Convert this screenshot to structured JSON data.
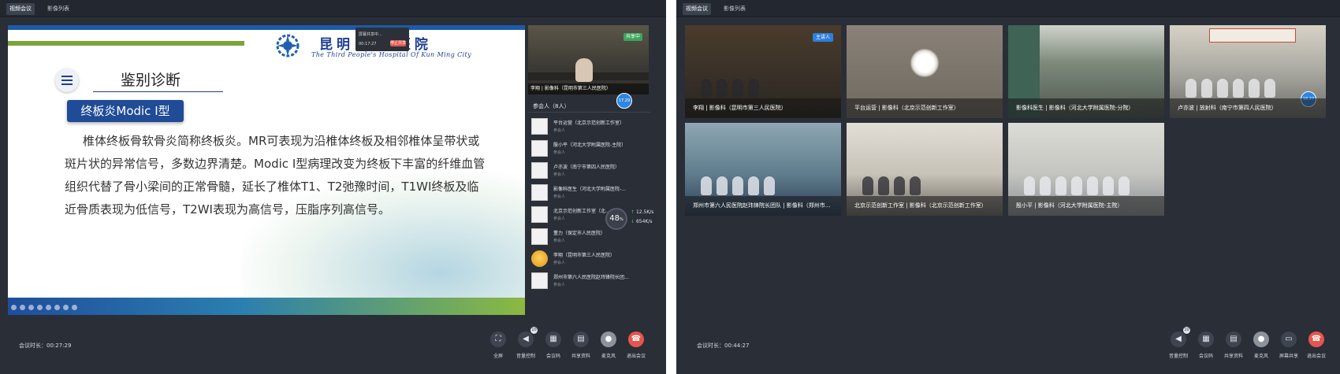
{
  "windowA": {
    "tabs": [
      {
        "label": "视频会议"
      },
      {
        "label": "影像列表"
      }
    ],
    "slide": {
      "hospital_cn": "昆明   人民医院",
      "hospital_en": "The Third People's Hospital Of Kun Ming City",
      "title": "鉴别诊断",
      "subtitle": "终板炎Modic I型",
      "body": "椎体终板骨软骨炎简称终板炎。MR可表现为沿椎体终板及相邻椎体呈带状或斑片状的异常信号，多数边界清楚。Modic I型病理改变为终板下丰富的纤维血管组织代替了骨小梁间的正常骨髓，延长了椎体T1、T2弛豫时间，T1WI终板及临近骨质表现为低信号，T2WI表现为高信号，压脂序列高信号。"
    },
    "popup": {
      "line1": "屏幕共享中...",
      "line2": "00:17:27",
      "button": "停止共享"
    },
    "camera": {
      "name": "李翔 | 影像科（昆明市第三人民医院）",
      "share_badge": "共享中"
    },
    "blue_badge": "17.29",
    "participants_header": "参会人（8人）",
    "participants": [
      {
        "name": "平台运营（北京示范创新工作室）",
        "role": "参会人"
      },
      {
        "name": "殷小平（河北大学附属医院-主院）",
        "role": "参会人"
      },
      {
        "name": "卢亦波（南宁市第四人民医院）",
        "role": "参会人"
      },
      {
        "name": "影像科医生（河北大学附属医院-...",
        "role": "参会人"
      },
      {
        "name": "北京示范创新工作室（北...",
        "role": "参会人"
      },
      {
        "name": "董力（保定市人民医院）",
        "role": "参会人"
      },
      {
        "name": "李翔（昆明市第三人民医院）",
        "role": "参会人"
      },
      {
        "name": "郑州市第六人民医院赵玮锋院长团...",
        "role": "参会人"
      }
    ],
    "speed": {
      "percent": "48",
      "unit": "%",
      "up": "12.5",
      "down": "654",
      "up_unit": "K/s",
      "down_unit": "K/s"
    },
    "duration": "会议时长：00:27:29",
    "controls": [
      {
        "label": "全屏",
        "icon": "fullscreen-icon",
        "glyph": "⛶"
      },
      {
        "label": "音量控制",
        "icon": "volume-icon",
        "glyph": "◀",
        "num": "10"
      },
      {
        "label": "会议码",
        "icon": "qrcode-icon",
        "glyph": "▦"
      },
      {
        "label": "共享资料",
        "icon": "document-icon",
        "glyph": "▤"
      },
      {
        "label": "麦克风",
        "icon": "microphone-icon",
        "glyph": "●"
      },
      {
        "label": "退出会议",
        "icon": "hangup-icon",
        "glyph": "☎"
      }
    ]
  },
  "windowB": {
    "tabs": [
      {
        "label": "视频会议"
      },
      {
        "label": "影像列表"
      }
    ],
    "host_badge": "主讲人",
    "tile4_badge": "18.27",
    "tiles": [
      {
        "name": "李翔 | 影像科（昆明市第三人民医院）"
      },
      {
        "name": "平台运营 | 影像科（北京示范创新工作室）"
      },
      {
        "name": "影像科医生 | 影像科（河北大学附属医院-分院）"
      },
      {
        "name": "卢亦波 | 放射科（南宁市第四人民医院）"
      },
      {
        "name": "郑州市第六人民医院赵玮锋院长团队 | 影像科（郑州市..."
      },
      {
        "name": "北京示范创新工作室 | 影像科（北京示范创新工作室）"
      },
      {
        "name": "殷小平 | 影像科（河北大学附属医院-主院）"
      }
    ],
    "duration": "会议时长：00:44:27",
    "controls": [
      {
        "label": "音量控制",
        "icon": "volume-icon",
        "glyph": "◀",
        "num": "10"
      },
      {
        "label": "会议码",
        "icon": "qrcode-icon",
        "glyph": "▦"
      },
      {
        "label": "共享资料",
        "icon": "document-icon",
        "glyph": "▤"
      },
      {
        "label": "麦克风",
        "icon": "microphone-icon",
        "glyph": "●"
      },
      {
        "label": "屏幕共享",
        "icon": "screen-share-icon",
        "glyph": "▭"
      },
      {
        "label": "退出会议",
        "icon": "hangup-icon",
        "glyph": "☎"
      }
    ]
  }
}
